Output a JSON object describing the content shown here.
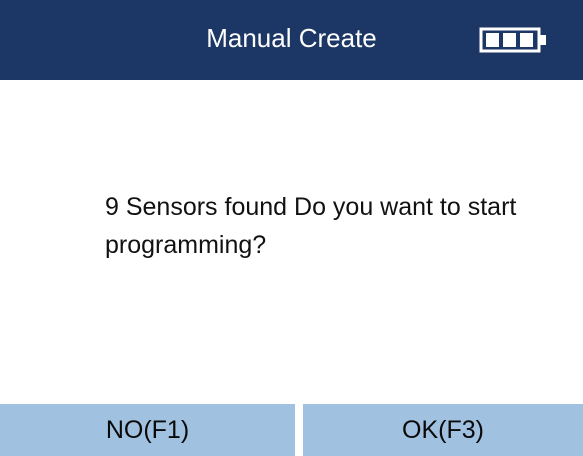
{
  "header": {
    "title": "Manual Create",
    "battery_icon": "battery-full-icon",
    "battery_level": 1.0
  },
  "dialog": {
    "message": "9 Sensors found Do you want to start programming?"
  },
  "softkeys": {
    "left_label": "NO(F1)",
    "right_label": "OK(F3)"
  },
  "colors": {
    "header_bg": "#1c3665",
    "softkey_bg": "#a0c1e0",
    "text": "#111111"
  }
}
